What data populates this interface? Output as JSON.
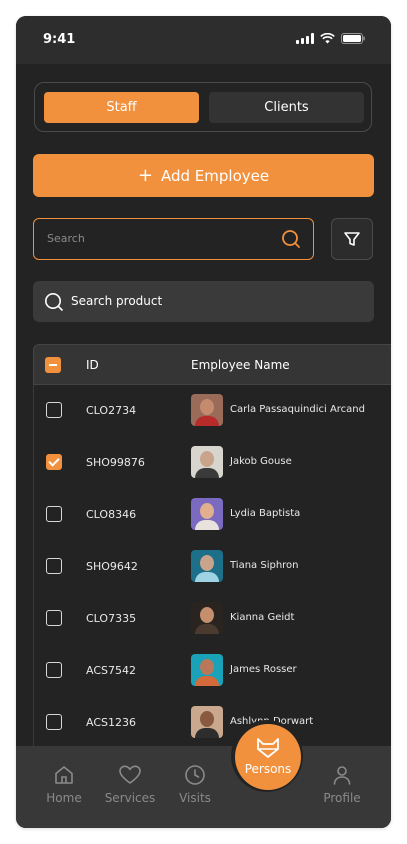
{
  "status_bar": {
    "time": "9:41"
  },
  "segment": {
    "staff": "Staff",
    "clients": "Clients",
    "selected": "Staff"
  },
  "add_employee": {
    "label": "Add Employee"
  },
  "search": {
    "placeholder": "Search"
  },
  "product_search": {
    "label": "Search product"
  },
  "table": {
    "columns": {
      "id": "ID",
      "name": "Employee Name"
    },
    "rows": [
      {
        "id": "CLO2734",
        "name": "Carla Passaquindici Arcand",
        "checked": false,
        "avatar_bg": "#9b6b5a",
        "head": "#c58b6e",
        "body": "#b72b2b"
      },
      {
        "id": "SHO99876",
        "name": "Jakob Gouse",
        "checked": true,
        "avatar_bg": "#d8d5cf",
        "head": "#caa48a",
        "body": "#3a3a3a"
      },
      {
        "id": "CLO8346",
        "name": "Lydia Baptista",
        "checked": false,
        "avatar_bg": "#7a6ac0",
        "head": "#e1b08e",
        "body": "#e9e2dc"
      },
      {
        "id": "SHO9642",
        "name": "Tiana Siphron",
        "checked": false,
        "avatar_bg": "#1d6f8a",
        "head": "#c9a48a",
        "body": "#9fd3e4"
      },
      {
        "id": "CLO7335",
        "name": "Kianna Geidt",
        "checked": false,
        "avatar_bg": "#2a2420",
        "head": "#c58e6c",
        "body": "#4a3a30"
      },
      {
        "id": "ACS7542",
        "name": "James Rosser",
        "checked": false,
        "avatar_bg": "#1aa3b8",
        "head": "#b9785a",
        "body": "#d46a3a"
      },
      {
        "id": "ACS1236",
        "name": "Ashlynn Dorwart",
        "checked": false,
        "avatar_bg": "#c9a88e",
        "head": "#8a5a40",
        "body": "#2d2d2d"
      }
    ]
  },
  "tabbar": {
    "home": "Home",
    "services": "Services",
    "visits": "Visits",
    "persons": "Persons",
    "profile": "Profile",
    "active": "Persons"
  },
  "colors": {
    "accent": "#f2913d",
    "background": "#232323",
    "inactive": "#8a8a8a"
  }
}
